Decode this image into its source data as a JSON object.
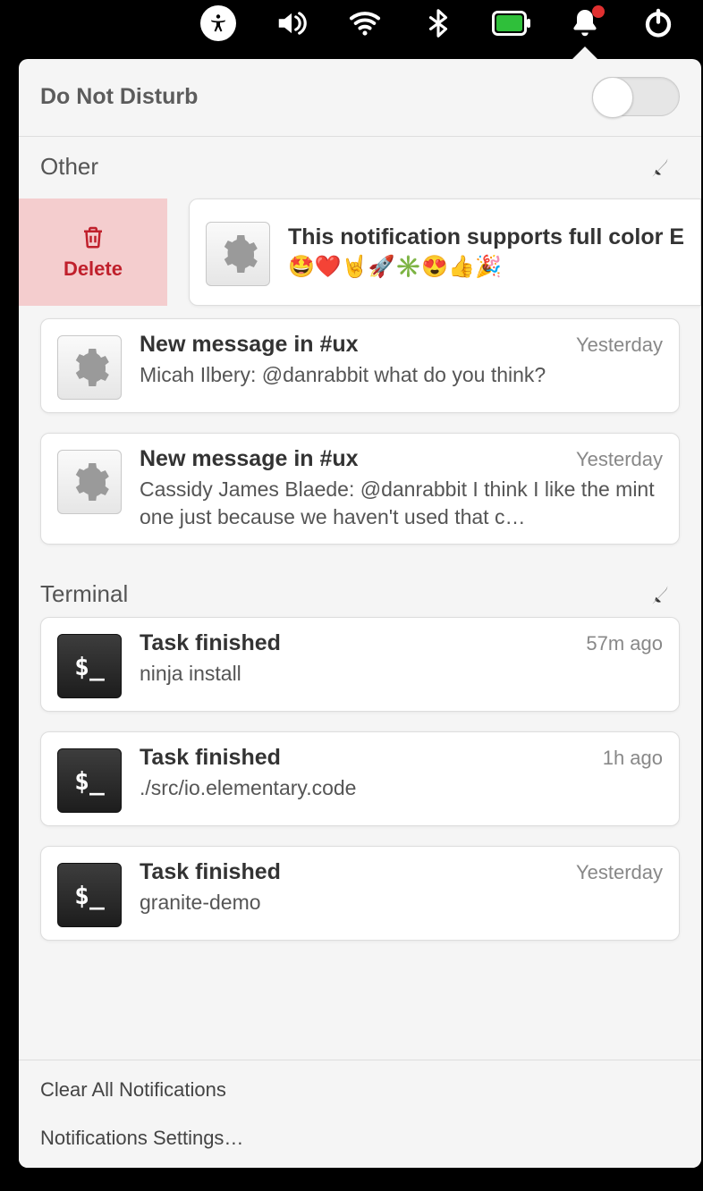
{
  "topbar": {
    "icons": [
      "accessibility",
      "volume",
      "wifi",
      "bluetooth",
      "battery",
      "notifications",
      "power"
    ],
    "notification_badge": true
  },
  "dnd": {
    "label": "Do Not Disturb",
    "enabled": false
  },
  "sections": [
    {
      "title": "Other",
      "swipe_item": {
        "delete_label": "Delete",
        "title": "This notification supports full color E",
        "emoji_text": "🤩❤️🤘🚀✳️😍👍🎉",
        "icon": "gear"
      },
      "items": [
        {
          "icon": "gear",
          "title": "New message in #ux",
          "time": "Yesterday",
          "body": "Micah Ilbery: @danrabbit what do you think?"
        },
        {
          "icon": "gear",
          "title": "New message in #ux",
          "time": "Yesterday",
          "body": "Cassidy James Blaede: @danrabbit I think I like the mint one just because we haven't used that c…"
        }
      ]
    },
    {
      "title": "Terminal",
      "items": [
        {
          "icon": "terminal",
          "title": "Task finished",
          "time": "57m ago",
          "body": "ninja install"
        },
        {
          "icon": "terminal",
          "title": "Task finished",
          "time": "1h ago",
          "body": "./src/io.elementary.code"
        },
        {
          "icon": "terminal",
          "title": "Task finished",
          "time": "Yesterday",
          "body": "granite-demo"
        }
      ]
    }
  ],
  "footer": {
    "clear_all": "Clear All Notifications",
    "settings": "Notifications Settings…"
  }
}
